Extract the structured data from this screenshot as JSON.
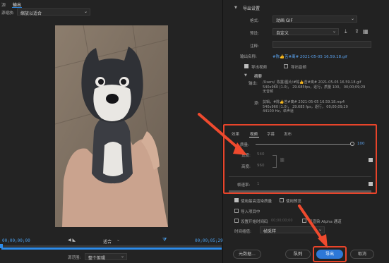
{
  "source_panel": {
    "tab_source": "源",
    "tab_output": "输出",
    "scaling_label": "源缩放:",
    "scaling_value": "缩放以适合",
    "timecode_in": "00;00;00;00",
    "timecode_out": "00;00;05;29",
    "fit_value": "适合",
    "source_range_label": "源范围:",
    "source_range_value": "整个剪辑"
  },
  "export_settings": {
    "section_title": "导出设置",
    "format_label": "格式:",
    "format_value": "动画 GIF",
    "preset_label": "预设:",
    "preset_value": "自定义",
    "comment_label": "注释:",
    "output_name_label": "输出名称:",
    "output_name_value": "#陈👍苦#离# 2021-05-05 16.59.18.gif",
    "export_video_label": "导出视频",
    "export_audio_label": "导出音频",
    "summary_title": "摘要",
    "summary_output_label": "输出:",
    "summary_output_lines": [
      "/Users/_陈露/图片/#陈👍苦#离# 2021-05-05 16.59.18.gif",
      "540x960 (1.0)， 29.685fps，逐行，质量 100， 00;00;09;29",
      "无音频"
    ],
    "summary_source_label": "源:",
    "summary_source_lines": [
      "剪辑，#陈👍苦#离# 2021-05-05 16.59.18.mp4",
      "540x960 (1.0)， 29.685 fps，逐行， 00;00;09;29",
      "44100 Hz，单声道"
    ]
  },
  "tabs": [
    "效果",
    "视频",
    "字幕",
    "发布"
  ],
  "video": {
    "quality_label": "质量:",
    "quality_value": "100",
    "width_label": "宽度:",
    "width_value": "540",
    "height_label": "高度:",
    "height_value": "960",
    "framerate_label": "帧速率:",
    "framerate_value": "1"
  },
  "options": {
    "max_render_label": "使用最高渲染质量",
    "use_preview_label": "使用预览",
    "import_project_label": "导入项目中",
    "set_start_tc_label": "设置开始时间码",
    "start_tc_value": "00;00;00;00",
    "render_alpha_label": "仅渲染 Alpha 通道",
    "time_interp_label": "时间插值:",
    "time_interp_value": "帧采样"
  },
  "buttons": {
    "metadata": "元数据...",
    "queue": "队列",
    "export": "导出",
    "cancel": "取消"
  },
  "colors": {
    "accent": "#2d8ceb",
    "annotation": "#e8442a"
  }
}
